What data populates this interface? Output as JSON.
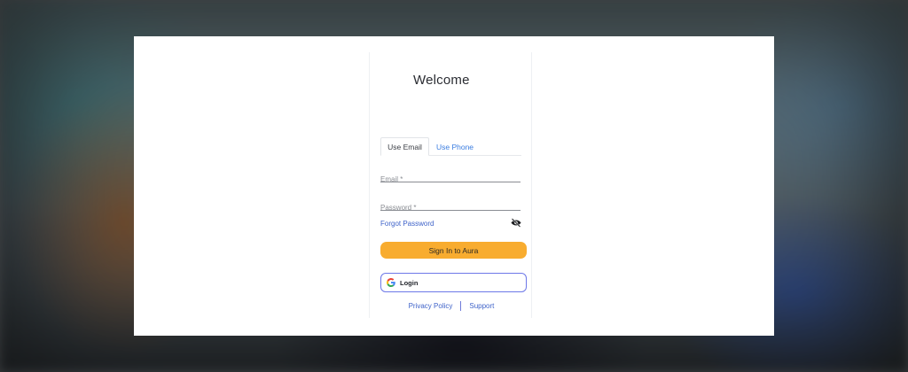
{
  "login": {
    "title": "Welcome",
    "tabs": [
      {
        "label": "Use Email",
        "active": true
      },
      {
        "label": "Use Phone",
        "active": false
      }
    ],
    "email": {
      "placeholder": "Email *",
      "value": ""
    },
    "password": {
      "placeholder": "Password *",
      "value": ""
    },
    "forgot_password": "Forgot Password",
    "toggle_visibility_icon": "eye-off-icon",
    "sign_in_button": "Sign In to Aura",
    "google_button": {
      "icon": "google-icon",
      "label": "Login"
    },
    "footer": {
      "privacy": "Privacy Policy",
      "support": "Support"
    }
  },
  "colors": {
    "accent_button": "#f8ac2f",
    "link": "#3f63c9",
    "active_tab_text": "#3a3d44",
    "inactive_tab_text": "#3b7de0",
    "google_border": "#6d78e8"
  }
}
